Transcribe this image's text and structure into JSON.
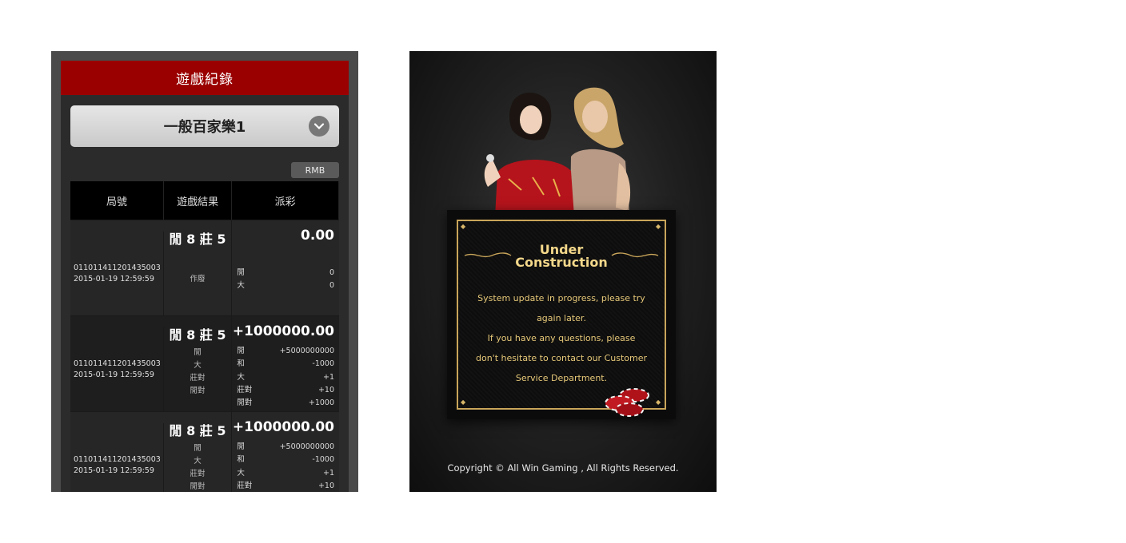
{
  "left_panel": {
    "header_title": "遊戲紀錄",
    "game_select": {
      "value": "一般百家樂1"
    },
    "currency_badge": "RMB",
    "table": {
      "headers": [
        "局號",
        "遊戲結果",
        "派彩"
      ],
      "rows": [
        {
          "round_id": "011011411201435003",
          "datetime": "2015-01-19  12:59:59",
          "result": "閒 8  莊 5",
          "result_tags": [
            "作廢"
          ],
          "payout": "0.00",
          "payout_lines": [
            {
              "label": "閒",
              "value": "0"
            },
            {
              "label": "大",
              "value": "0"
            }
          ]
        },
        {
          "round_id": "011011411201435003",
          "datetime": "2015-01-19  12:59:59",
          "result": "閒 8  莊 5",
          "result_tags": [
            "閒",
            "大",
            "莊對",
            "閒對"
          ],
          "payout": "+1000000.00",
          "payout_lines": [
            {
              "label": "閒",
              "value": "+5000000000"
            },
            {
              "label": "和",
              "value": "-1000"
            },
            {
              "label": "大",
              "value": "+1"
            },
            {
              "label": "莊對",
              "value": "+10"
            },
            {
              "label": "閒對",
              "value": "+1000"
            }
          ]
        },
        {
          "round_id": "011011411201435003",
          "datetime": "2015-01-19  12:59:59",
          "result": "閒 8  莊 5",
          "result_tags": [
            "閒",
            "大",
            "莊對",
            "閒對"
          ],
          "payout": "+1000000.00",
          "payout_lines": [
            {
              "label": "閒",
              "value": "+5000000000"
            },
            {
              "label": "和",
              "value": "-1000"
            },
            {
              "label": "大",
              "value": "+1"
            },
            {
              "label": "莊對",
              "value": "+10"
            }
          ]
        }
      ]
    },
    "colors": {
      "header_bg": "#9a0000",
      "panel_bg": "#2b2b2b"
    }
  },
  "right_panel": {
    "notice_title_line1": "Under",
    "notice_title_line2": "Construction",
    "message_lines": [
      "System update in progress, please try",
      "again later.",
      "If you have any questions, please",
      "don't hesitate to contact our Customer",
      "Service Department."
    ],
    "copyright": "Copyright © All Win Gaming , All Rights Reserved.",
    "colors": {
      "gold": "#c9a55a",
      "text_gold": "#e6c878"
    },
    "decor": [
      "hostess-illustration",
      "casino-chips-icon"
    ]
  }
}
